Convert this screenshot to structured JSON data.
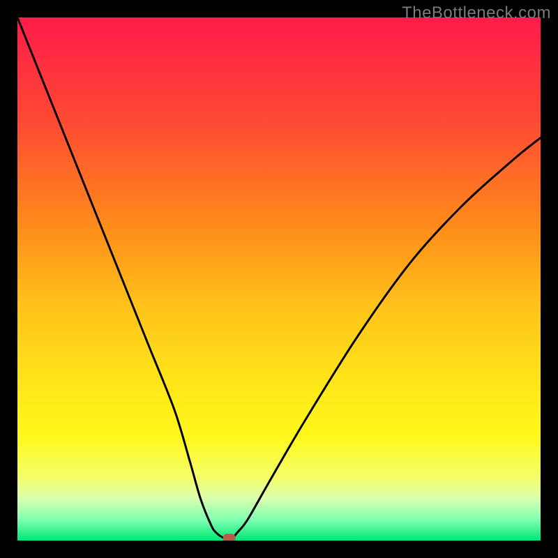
{
  "watermark": "TheBottleneck.com",
  "chart_data": {
    "type": "line",
    "title": "",
    "xlabel": "",
    "ylabel": "",
    "xlim": [
      0,
      100
    ],
    "ylim": [
      0,
      100
    ],
    "series": [
      {
        "name": "curve",
        "x": [
          0,
          5,
          10,
          15,
          20,
          25,
          30,
          33,
          35,
          37,
          38,
          39.5,
          41,
          42,
          44,
          48,
          55,
          65,
          75,
          85,
          95,
          100
        ],
        "y": [
          100,
          87.5,
          75,
          62.5,
          50,
          37.5,
          25,
          15,
          8,
          3,
          1.5,
          0.5,
          0.5,
          1.5,
          4,
          11,
          23,
          39,
          53,
          64,
          73,
          77
        ]
      }
    ],
    "marker": {
      "x": 40.5,
      "y": 0.5
    },
    "background": {
      "type": "vertical_gradient",
      "stops": [
        {
          "pos": 0.0,
          "color": "#ff1a4a"
        },
        {
          "pos": 0.2,
          "color": "#ff4a33"
        },
        {
          "pos": 0.4,
          "color": "#ff8c1a"
        },
        {
          "pos": 0.55,
          "color": "#ffc21a"
        },
        {
          "pos": 0.7,
          "color": "#ffe61a"
        },
        {
          "pos": 0.8,
          "color": "#fff81a"
        },
        {
          "pos": 0.88,
          "color": "#f4ff6a"
        },
        {
          "pos": 0.92,
          "color": "#d9ffb0"
        },
        {
          "pos": 0.96,
          "color": "#80ffb0"
        },
        {
          "pos": 1.0,
          "color": "#00e676"
        }
      ]
    }
  }
}
